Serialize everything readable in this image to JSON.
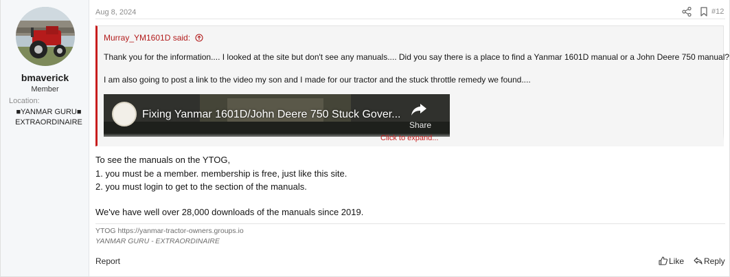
{
  "post": {
    "date": "Aug 8, 2024",
    "number": "#12"
  },
  "user": {
    "name": "bmaverick",
    "title": "Member",
    "location_label": "Location:",
    "location_line1": "■YANMAR GURU■",
    "location_line2": "EXTRAORDINAIRE"
  },
  "quote": {
    "author": "Murray_YM1601D said:",
    "line1": "Thank you for the information.... I looked at the site but don't see any manuals.... Did you say there is a place to find a Yanmar 1601D manual or a John Deere 750 manual?",
    "line2": "I am also going to post a link to the video my son and I made for our tractor and the stuck throttle remedy we found....",
    "video_title": "Fixing Yanmar 1601D/John Deere 750 Stuck Gover...",
    "video_share_label": "Share",
    "expand_label": "Click to expand..."
  },
  "body": {
    "line1": "To see the manuals on the YTOG,",
    "line2": "1. you must be a member. membership is free, just like this site.",
    "line3": "2. you must login to get to the section of the manuals.",
    "line4": "We've have well over 28,000 downloads of the manuals since 2019."
  },
  "signature": {
    "line1": "YTOG https://yanmar-tractor-owners.groups.io",
    "line2": "YANMAR GURU - EXTRAORDINAIRE"
  },
  "actions": {
    "report": "Report",
    "like": "Like",
    "reply": "Reply"
  },
  "colors": {
    "accent": "#c81d1d",
    "sidebar_bg": "#f5f7f9",
    "quote_bg": "#f5f5f5"
  },
  "icons": {
    "share": "share-icon",
    "bookmark": "bookmark-icon",
    "quote_jump": "arrow-up-circle-icon",
    "like": "thumbs-up-icon",
    "reply": "reply-arrow-icon"
  }
}
